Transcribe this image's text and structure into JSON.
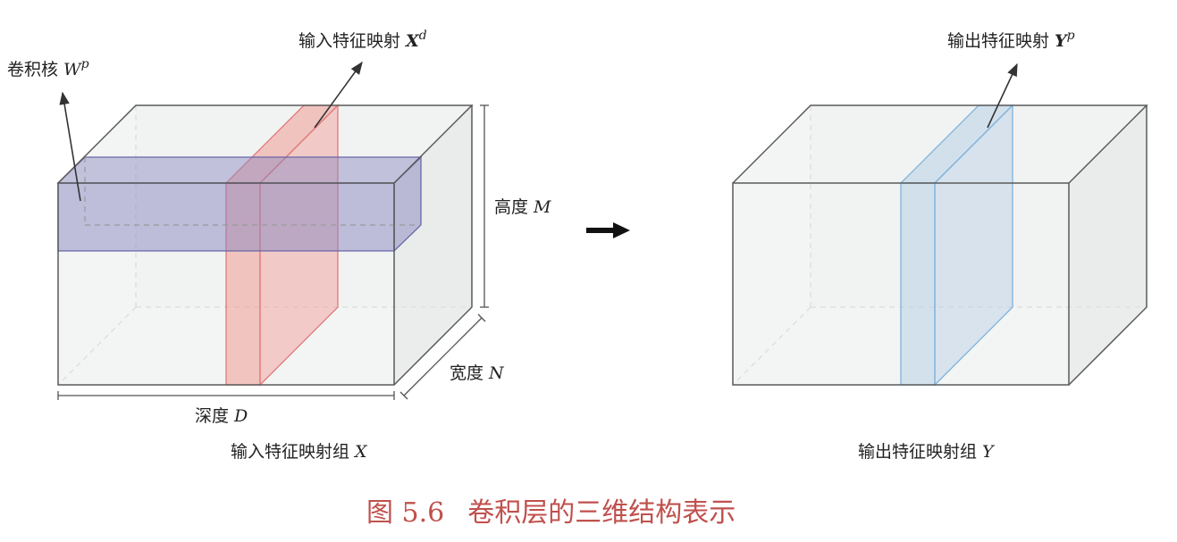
{
  "labels": {
    "kernel_text": "卷积核 ",
    "kernel_symbol": "W",
    "kernel_sup": "p",
    "input_map_text": "输入特征映射 ",
    "input_map_symbol": "X",
    "input_map_sup": "d",
    "output_map_text": "输出特征映射 ",
    "output_map_symbol": "Y",
    "output_map_sup": "p",
    "height_text": "高度 ",
    "height_symbol": "M",
    "width_text": "宽度 ",
    "width_symbol": "N",
    "depth_text": "深度 ",
    "depth_symbol": "D",
    "input_group_text": "输入特征映射组 ",
    "input_group_symbol": "X",
    "output_group_text": "输出特征映射组 ",
    "output_group_symbol": "Y"
  },
  "caption": {
    "number": "图 5.6",
    "title": "卷积层的三维结构表示"
  },
  "colors": {
    "box_fill": "#eef1f0",
    "box_edge": "#5a5a5a",
    "kernel_fill": "#8a86bf",
    "kernel_edge": "#6a66a8",
    "input_slice_fill": "#f19a95",
    "input_slice_edge": "#e07a76",
    "output_slice_fill": "#b8cfe6",
    "output_slice_edge": "#7fb2dc",
    "caption": "#c0504d",
    "text": "#222222"
  },
  "icons": {
    "transform_arrow": "arrow-right-icon"
  }
}
